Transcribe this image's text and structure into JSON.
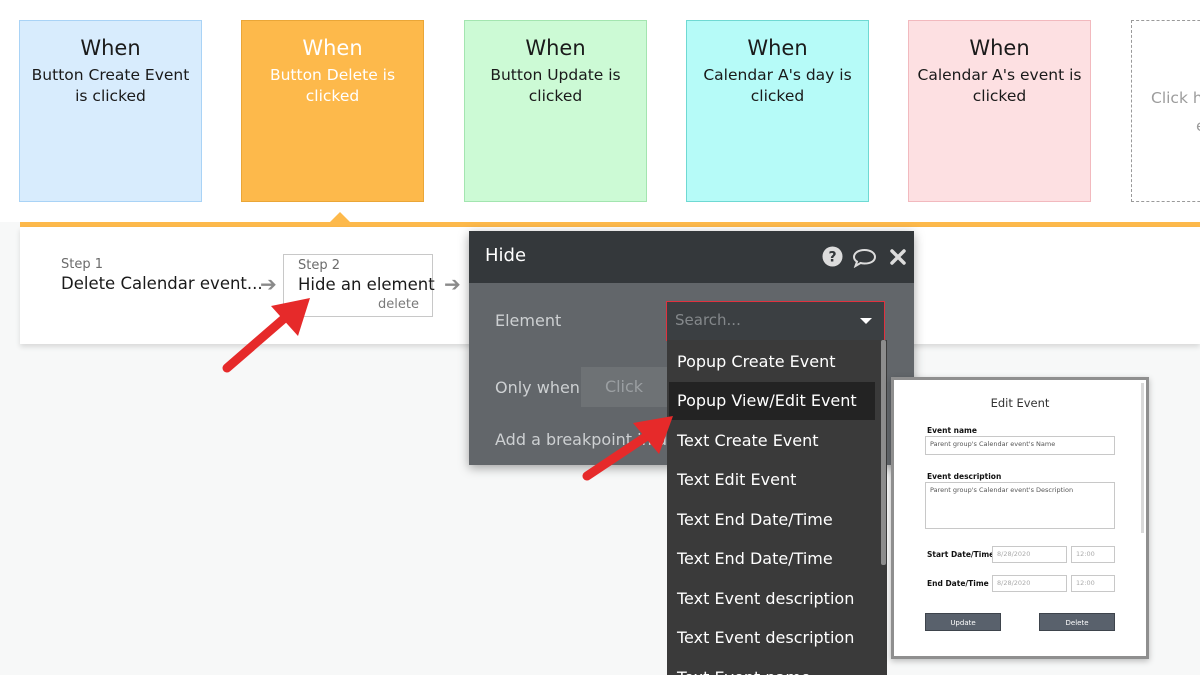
{
  "events": [
    {
      "when": "When",
      "description": "Button Create Event is clicked",
      "bg": "#d8ecfd",
      "border": "#a9d3f6",
      "text_color": "#1a1a1a"
    },
    {
      "when": "When",
      "description": "Button Delete is clicked",
      "bg": "#fdb94b",
      "border": "#eaa637",
      "text_color": "#ffffff"
    },
    {
      "when": "When",
      "description": "Button Update is clicked",
      "bg": "#ccfad5",
      "border": "#a3e5b0",
      "text_color": "#1a1a1a"
    },
    {
      "when": "When",
      "description": "Calendar A's day is clicked",
      "bg": "#b6fbf8",
      "border": "#6fd9d3",
      "text_color": "#1a1a1a"
    },
    {
      "when": "When",
      "description": "Calendar A's event is clicked",
      "bg": "#fde0e2",
      "border": "#f2b9be",
      "text_color": "#1a1a1a"
    }
  ],
  "placeholder_card": {
    "line1": "Click he",
    "line2": "e"
  },
  "steps": [
    {
      "label": "Step 1",
      "title": "Delete Calendar event..."
    },
    {
      "label": "Step 2",
      "title": "Hide an element",
      "delete": "delete"
    }
  ],
  "hide_dialog": {
    "title": "Hide",
    "element_label": "Element",
    "search_placeholder": "Search...",
    "only_when_label": "Only when",
    "click_button": "Click",
    "breakpoint_label": "Add a breakpoint in debug"
  },
  "dropdown": {
    "items": [
      "Popup Create Event",
      "Popup View/Edit Event",
      "Text Create Event",
      "Text Edit Event",
      "Text End Date/Time",
      "Text End Date/Time",
      "Text Event description",
      "Text Event description",
      "Text Event name"
    ],
    "selected_index": 1
  },
  "preview": {
    "title": "Edit Event",
    "event_name_label": "Event name",
    "event_name_value": "Parent group's Calendar event's Name",
    "description_label": "Event description",
    "description_value": "Parent group's Calendar event's Description",
    "start_label": "Start Date/Time",
    "start_date": "8/28/2020",
    "start_time": "12:00",
    "end_label": "End Date/Time",
    "end_date": "8/28/2020",
    "end_time": "12:00",
    "update_button": "Update",
    "delete_button": "Delete"
  },
  "icons": {
    "help": "question-circle-icon",
    "comment": "speech-bubble-icon",
    "close": "close-icon",
    "arrow": "red-pointer-arrow"
  },
  "colors": {
    "accent_orange": "#fdb94b",
    "dialog_header": "#34383b",
    "dialog_body": "#62666a",
    "dropdown_bg": "#3a3a3a",
    "error_border": "#e0323f",
    "pointer_red": "#e62a2a"
  }
}
